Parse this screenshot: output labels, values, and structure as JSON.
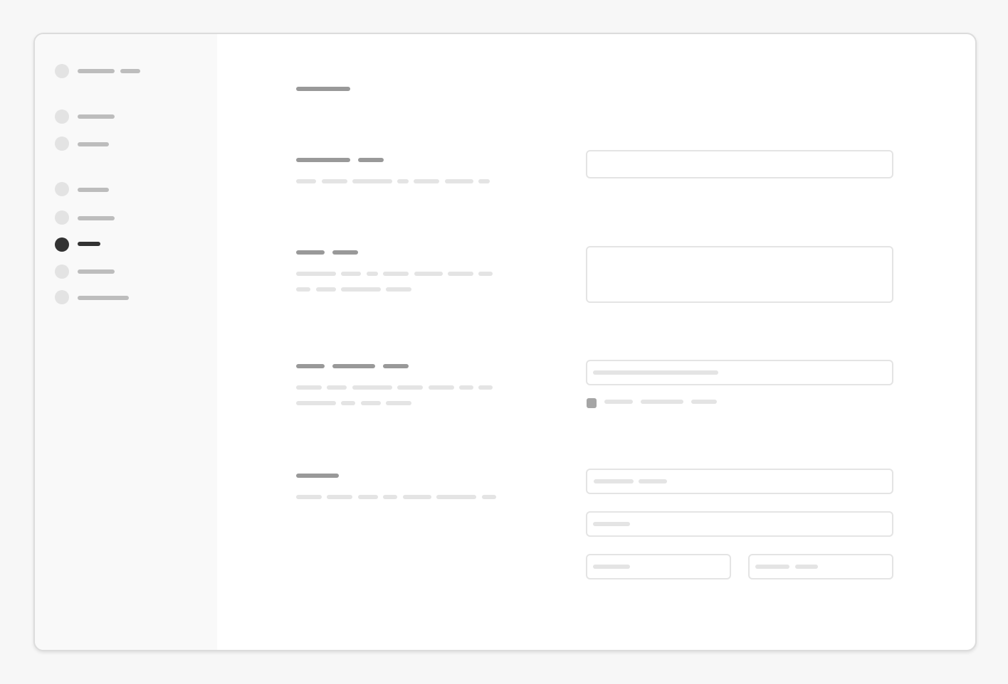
{
  "app": {
    "title": ""
  },
  "sidebar": {
    "items": [
      {
        "id": "header",
        "active": false
      },
      {
        "id": "item-1",
        "active": false
      },
      {
        "id": "item-2",
        "active": false
      },
      {
        "id": "item-3",
        "active": false
      },
      {
        "id": "item-4",
        "active": false
      },
      {
        "id": "item-5",
        "active": true
      },
      {
        "id": "item-6",
        "active": false
      },
      {
        "id": "item-7",
        "active": false
      }
    ]
  },
  "main": {
    "title": "",
    "sections": [
      {
        "id": "section-1",
        "heading": "",
        "description": "",
        "field_value": ""
      },
      {
        "id": "section-2",
        "heading": "",
        "description": "",
        "field_value": ""
      },
      {
        "id": "section-3",
        "heading": "",
        "description": "",
        "field_placeholder": "",
        "checkbox_label": "",
        "checkbox_checked": true
      },
      {
        "id": "section-4",
        "heading": "",
        "description": "",
        "fields": [
          "",
          "",
          "",
          ""
        ]
      }
    ]
  },
  "colors": {
    "active": "#333333",
    "placeholder_dark": "#999999",
    "placeholder_light": "#e4e4e4",
    "sidebar_bg": "#f9f9f9",
    "window_border": "#dcdcdc"
  },
  "icons": {
    "nav_item": "dot-icon",
    "nav_item_active": "dot-icon-active"
  }
}
